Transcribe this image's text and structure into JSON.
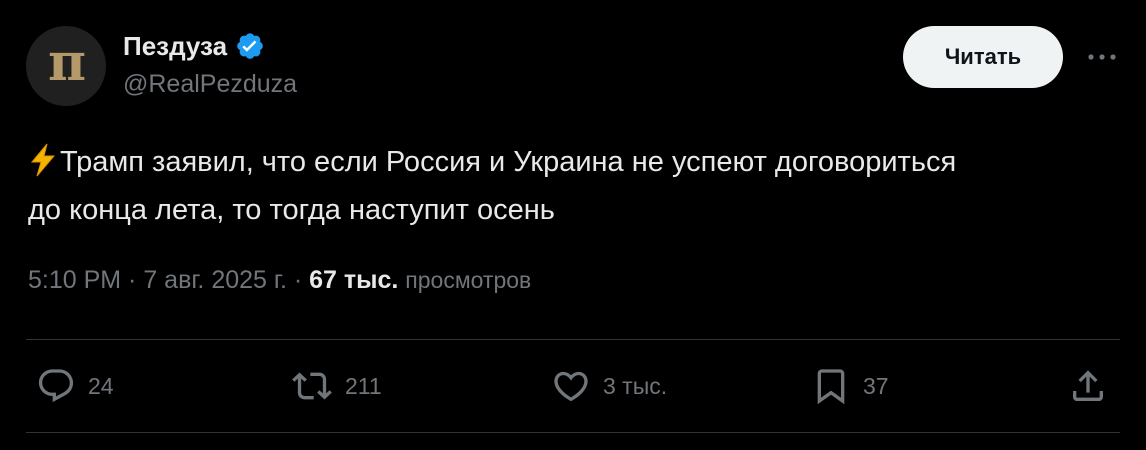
{
  "author": {
    "avatar_letter": "п",
    "display_name": "Пездуза",
    "handle": "@RealPezduza"
  },
  "follow_label": "Читать",
  "tweet": {
    "text_line1": "Трамп заявил, что если Россия и Украина не успеют договориться",
    "text_line2": "до конца лета, то тогда наступит осень"
  },
  "meta": {
    "time": "5:10 PM",
    "separator": " · ",
    "date": "7 авг. 2025 г.",
    "views_count": "67 тыс.",
    "views_label": "просмотров"
  },
  "actions": {
    "replies": "24",
    "reposts": "211",
    "likes": "3 тыс.",
    "bookmarks": "37"
  },
  "colors": {
    "background": "#000000",
    "text": "#e7e9ea",
    "secondary": "#71767b",
    "verified": "#1d9bf0",
    "divider": "#2f3336",
    "bolt": "#f4b400"
  },
  "icons": [
    "verified-badge-icon",
    "more-icon",
    "lightning-icon",
    "reply-icon",
    "repost-icon",
    "like-icon",
    "bookmark-icon",
    "share-icon"
  ]
}
